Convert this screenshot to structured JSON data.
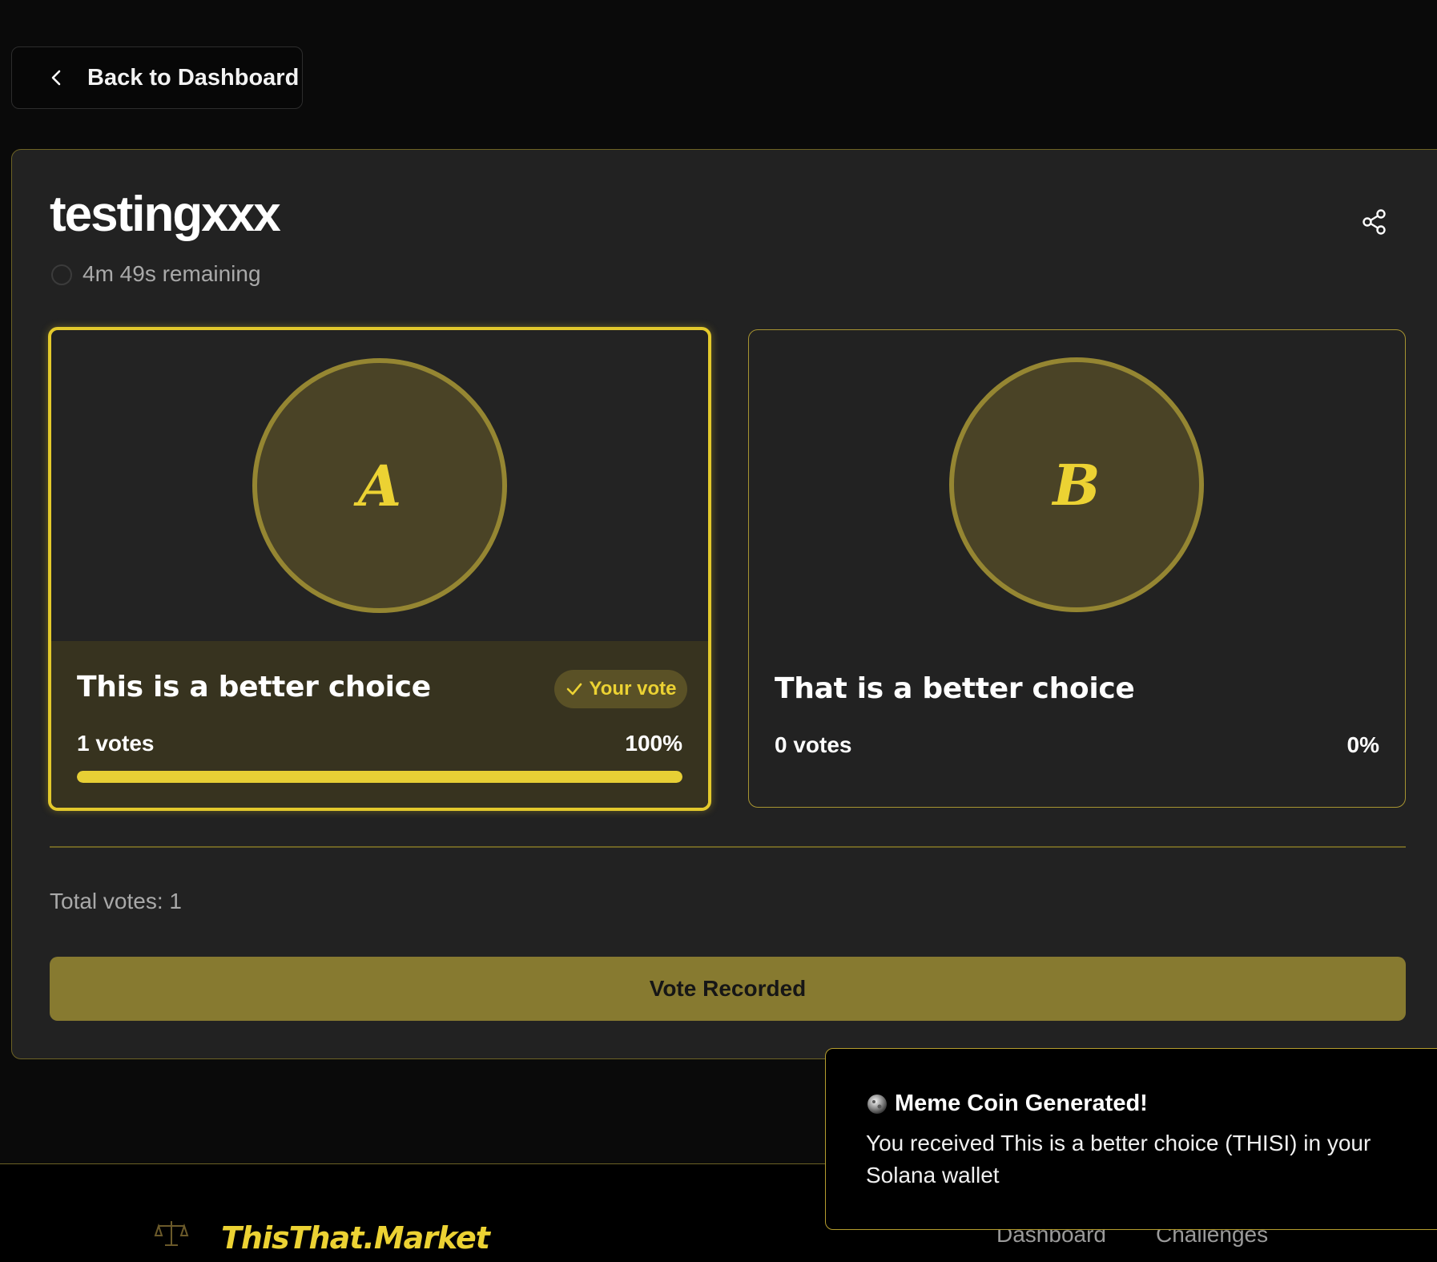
{
  "nav": {
    "back_label": "Back to Dashboard"
  },
  "poll": {
    "title": "testingxxx",
    "timer": "4m 49s remaining",
    "total_votes": "Total votes: 1",
    "vote_button": "Vote Recorded",
    "options": [
      {
        "letter": "A",
        "label": "This is a better choice",
        "votes": "1 votes",
        "percent": "100%",
        "fraction": 1.0,
        "your_vote": "Your vote"
      },
      {
        "letter": "B",
        "label": "That is a better choice",
        "votes": "0 votes",
        "percent": "0%",
        "fraction": 0.0
      }
    ]
  },
  "toast": {
    "title": "Meme Coin Generated!",
    "body": "You received This is a better choice (THISI) in your Solana wallet"
  },
  "footer": {
    "brand": "ThisThat.Market",
    "links": [
      "Dashboard",
      "Challenges"
    ]
  },
  "colors": {
    "accent": "#e3c92c",
    "panel": "#222222",
    "button": "#877a30"
  },
  "icons": [
    "chevron-left-icon",
    "share-icon",
    "timer-icon",
    "check-icon",
    "coin-icon",
    "scales-icon"
  ]
}
